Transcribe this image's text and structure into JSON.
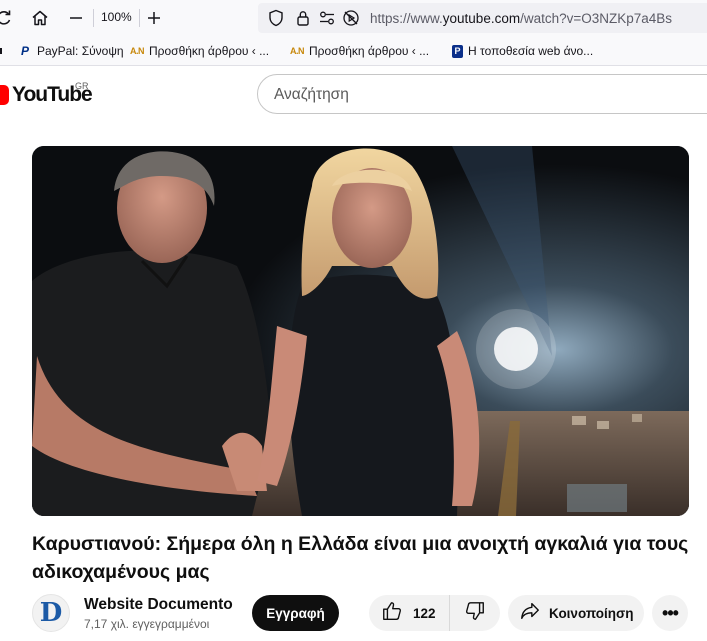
{
  "browser": {
    "zoom": "100%",
    "url_prefix": "https://www.",
    "url_host": "youtube.com",
    "url_path": "/watch?v=O3NZKp7a4Bs",
    "bookmarks": [
      {
        "icon": "P",
        "label": "PayPal: Σύνοψη"
      },
      {
        "icon": "A.N",
        "label": "Προσθήκη άρθρου ‹ ..."
      },
      {
        "icon": "A.N",
        "label": "Προσθήκη άρθρου ‹ ..."
      },
      {
        "icon": "P",
        "label": "Η τοποθεσία web άνο..."
      }
    ]
  },
  "youtube": {
    "logo_text": "YouTube",
    "region": "GR",
    "search_placeholder": "Αναζήτηση",
    "colors": {
      "brand_red": "#ff0000",
      "subscribe_bg": "#0f0f0f"
    }
  },
  "video": {
    "title": "Καρυστιανού: Σήμερα όλη η Ελλάδα είναι μια ανοιχτή αγκαλιά για τους αδικοχαμένους μας",
    "channel_initial": "D",
    "channel_name": "Website Documento",
    "subscribers": "7,17 χιλ. εγγεγραμμένοι",
    "subscribe_label": "Εγγραφή",
    "like_count": "122",
    "share_label": "Κοινοποίηση"
  }
}
